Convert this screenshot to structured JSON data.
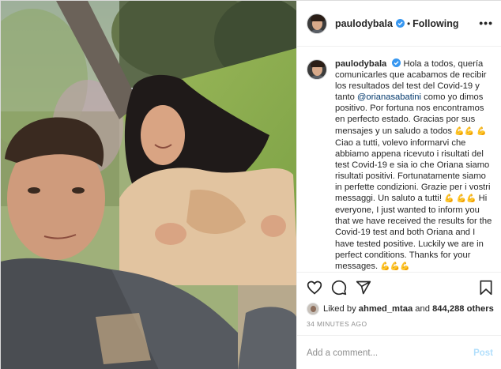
{
  "post": {
    "username": "paulodybala",
    "header_separator": "•",
    "follow_status": "Following",
    "more_icon": "more-horizontal-icon"
  },
  "caption": {
    "username": "paulodybala",
    "es_part1": "Hola a todos, quería comunicarles que acabamos de recibir los resultados del test del Covid-19 y tanto",
    "mention": "@orianasabatini",
    "es_part2": "como yo dimos positivo. Por fortuna nos encontramos en perfecto estado. Gracias por sus mensajes y un saludo a todos",
    "it_text": "Ciao a tutti, volevo informarvi che abbiamo appena ricevuto i risultati del test Covid-19 e sia io che Oriana siamo risultati positivi. Fortunatamente siamo in perfette condizioni. Grazie per i vostri messaggi. Un saluto a tutti!",
    "en_text": "Hi everyone, I just wanted to inform you that we have received the results for the Covid-19 test and both Oriana and I have tested positive. Luckily we are in perfect conditions. Thanks for your messages.",
    "emoji_pair": "💪💪",
    "emoji_single": "💪",
    "emoji_triple": "💪💪💪"
  },
  "likes": {
    "prefix": "Liked by",
    "user": "ahmed_mtaa",
    "conjunction": "and",
    "count": "844,288 others"
  },
  "timestamp": "34 MINUTES AGO",
  "comment": {
    "placeholder": "Add a comment...",
    "post_label": "Post"
  },
  "colors": {
    "verified": "#3897f0",
    "post_button_disabled": "#b2dffc",
    "mention": "#00376b"
  }
}
